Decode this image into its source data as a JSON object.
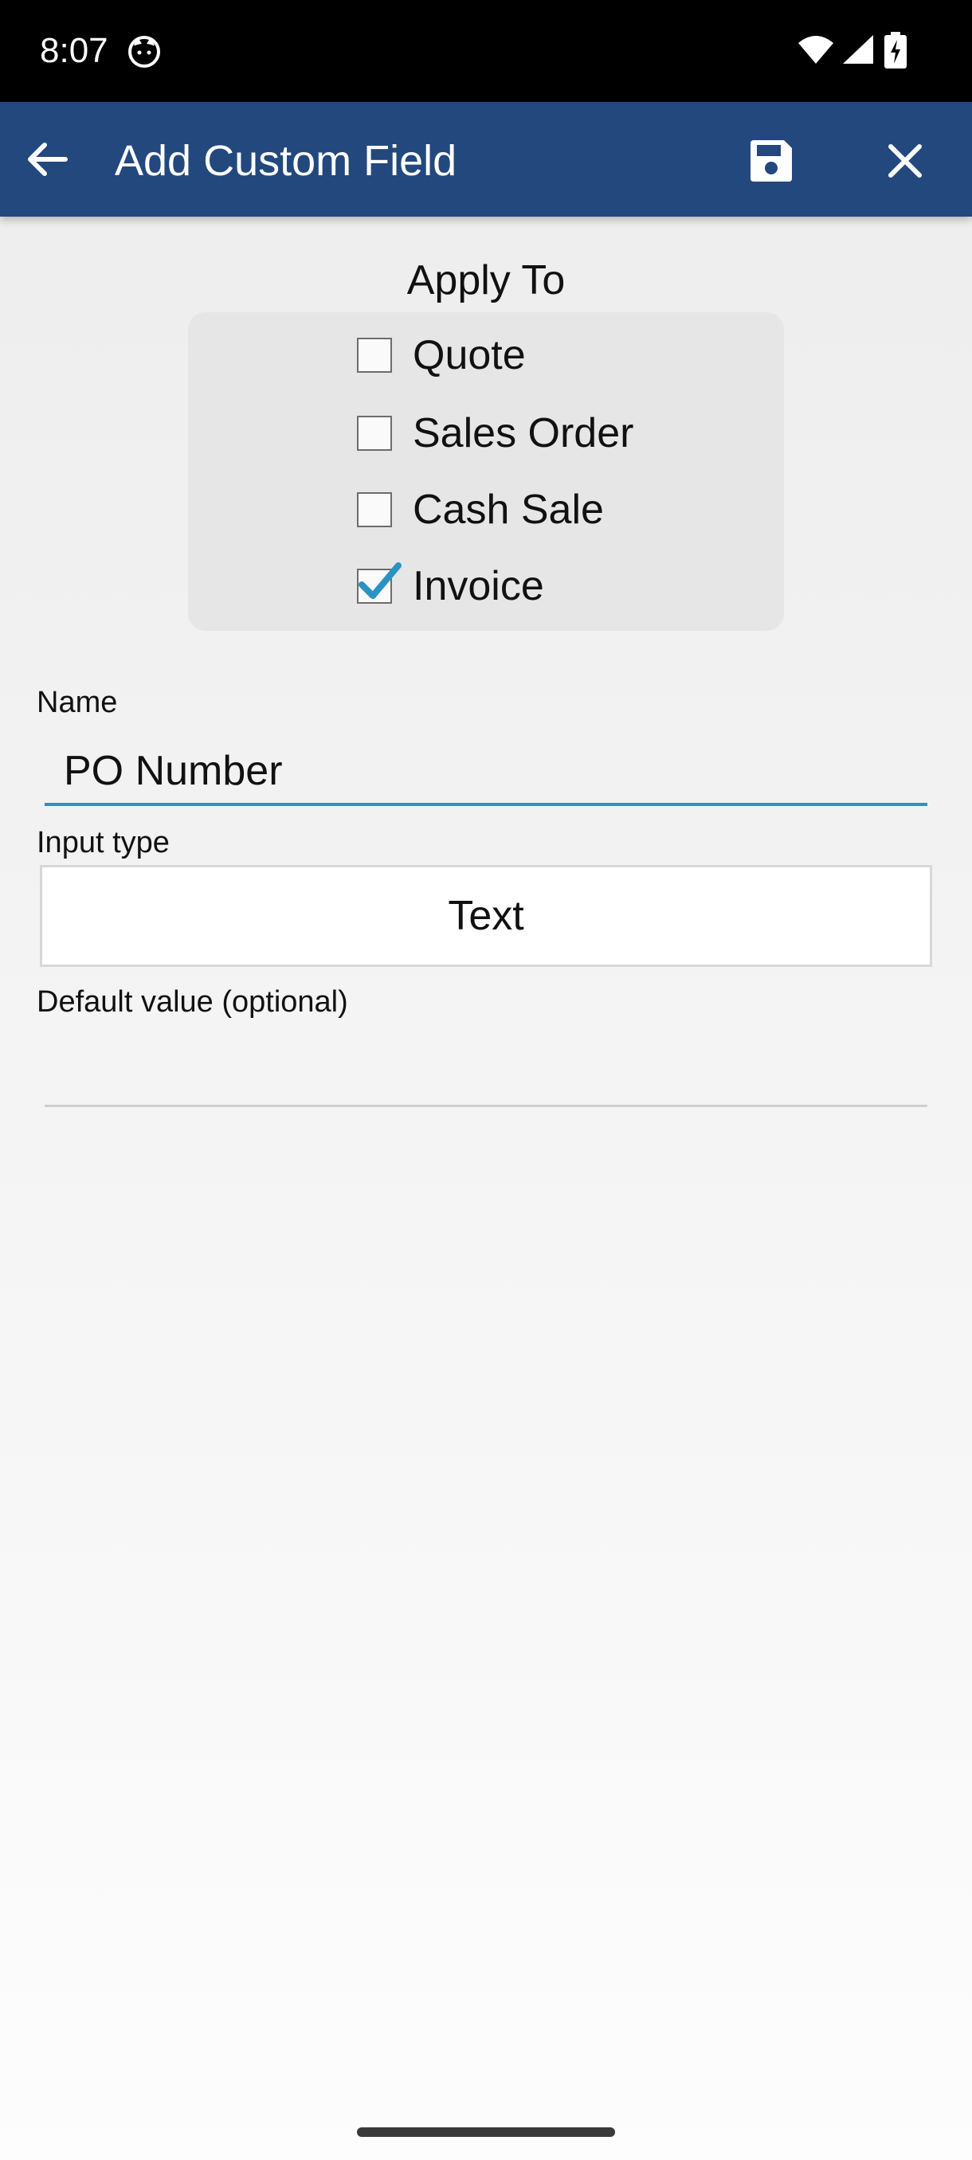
{
  "status_bar": {
    "time": "8:07",
    "icons": [
      "cat-notification-icon",
      "wifi-icon",
      "signal-icon",
      "battery-charging-icon"
    ]
  },
  "app_bar": {
    "title": "Add Custom Field",
    "background_color": "#22487e",
    "icons": [
      "back-arrow-icon",
      "save-icon",
      "close-icon"
    ]
  },
  "apply_to": {
    "heading": "Apply To",
    "options": [
      {
        "label": "Quote",
        "checked": false
      },
      {
        "label": "Sales Order",
        "checked": false
      },
      {
        "label": "Cash Sale",
        "checked": false
      },
      {
        "label": "Invoice",
        "checked": true
      }
    ],
    "check_color": "#2a93c4"
  },
  "form": {
    "name_label": "Name",
    "name_value": "PO Number",
    "input_type_label": "Input type",
    "input_type_value": "Text",
    "default_label": "Default value (optional)",
    "default_value": "",
    "focus_color": "#2a93c4"
  }
}
